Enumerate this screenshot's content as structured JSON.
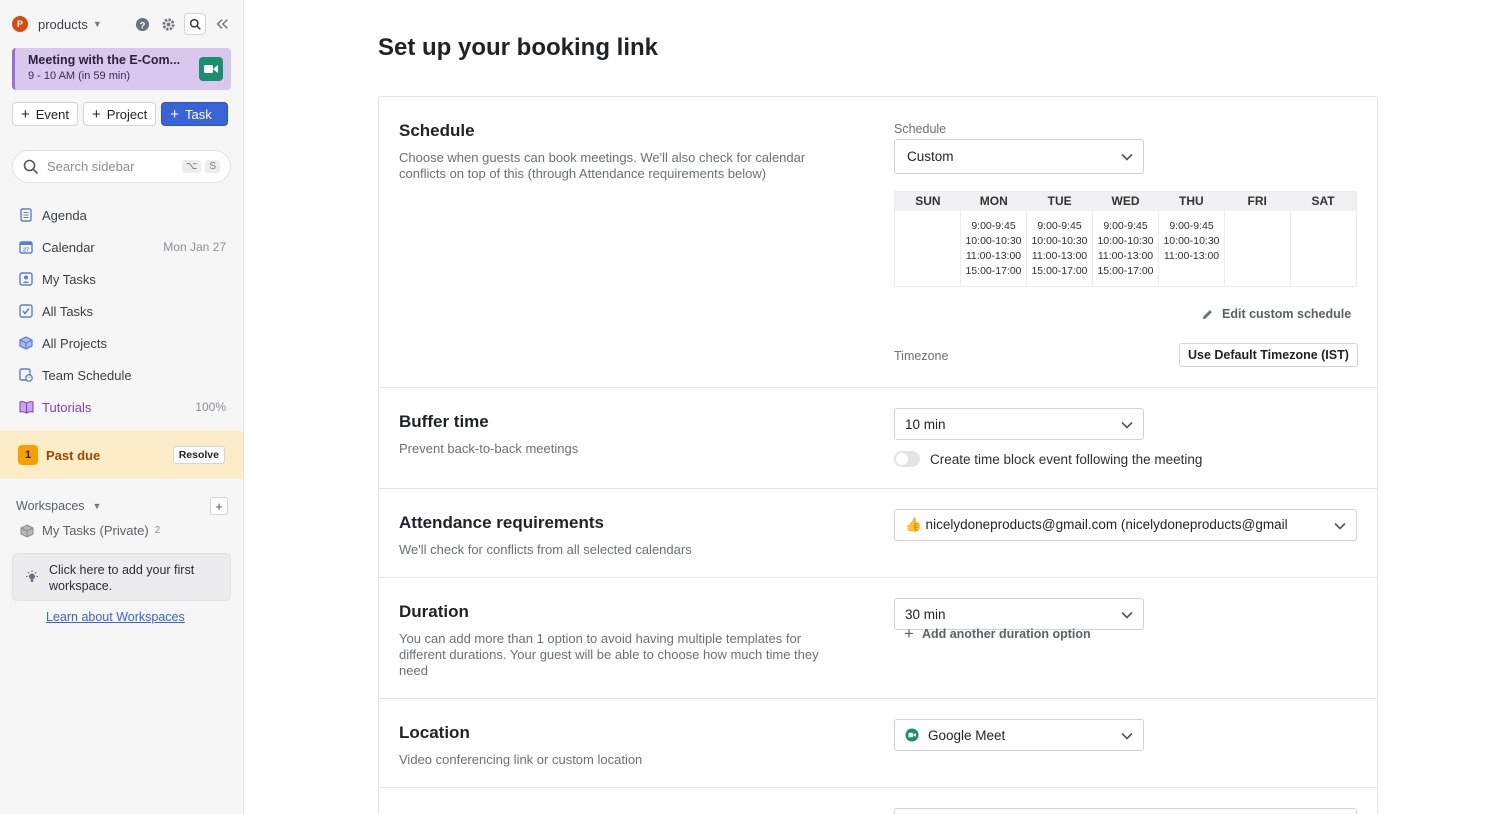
{
  "sidebar": {
    "workspace": {
      "initial": "P",
      "name": "products"
    },
    "meeting": {
      "title": "Meeting with the E-Com...",
      "time": "9 - 10 AM (in 59 min)"
    },
    "create": {
      "event": "Event",
      "project": "Project",
      "task": "Task"
    },
    "search": {
      "placeholder": "Search sidebar",
      "shortcut_a": "⌥",
      "shortcut_b": "S"
    },
    "nav": [
      {
        "label": "Agenda",
        "meta": ""
      },
      {
        "label": "Calendar",
        "meta": "Mon Jan 27"
      },
      {
        "label": "My Tasks",
        "meta": ""
      },
      {
        "label": "All Tasks",
        "meta": ""
      },
      {
        "label": "All Projects",
        "meta": ""
      },
      {
        "label": "Team Schedule",
        "meta": ""
      },
      {
        "label": "Tutorials",
        "meta": "100%"
      }
    ],
    "past_due": {
      "count": "1",
      "label": "Past due",
      "action": "Resolve"
    },
    "workspaces": {
      "header": "Workspaces",
      "private_label": "My Tasks (Private)",
      "private_count": "2",
      "tip": "Click here to add your first workspace.",
      "learn_link": "Learn about Workspaces"
    }
  },
  "main": {
    "title": "Set up your booking link",
    "schedule": {
      "title": "Schedule",
      "desc": "Choose when guests can book meetings. We'll also check for calendar conflicts on top of this (through Attendance requirements below)",
      "field_label": "Schedule",
      "value": "Custom",
      "days": [
        "SUN",
        "MON",
        "TUE",
        "WED",
        "THU",
        "FRI",
        "SAT"
      ],
      "slots": {
        "sun": [],
        "mon": [
          "9:00-9:45",
          "10:00-10:30",
          "11:00-13:00",
          "15:00-17:00"
        ],
        "tue": [
          "9:00-9:45",
          "10:00-10:30",
          "11:00-13:00",
          "15:00-17:00"
        ],
        "wed": [
          "9:00-9:45",
          "10:00-10:30",
          "11:00-13:00",
          "15:00-17:00"
        ],
        "thu": [
          "9:00-9:45",
          "10:00-10:30",
          "11:00-13:00"
        ],
        "fri": [],
        "sat": []
      },
      "edit_label": "Edit custom schedule",
      "timezone_label": "Timezone",
      "timezone_button": "Use Default Timezone (IST)"
    },
    "buffer": {
      "title": "Buffer time",
      "desc": "Prevent back-to-back meetings",
      "value": "10 min",
      "toggle_label": "Create time block event following the meeting",
      "toggle_on": false
    },
    "attendance": {
      "title": "Attendance requirements",
      "desc": "We'll check for conflicts from all selected calendars",
      "value": "👍 nicelydoneproducts@gmail.com (nicelydoneproducts@gmail"
    },
    "duration": {
      "title": "Duration",
      "desc": "You can add more than 1 option to avoid having multiple templates for different durations. Your guest will be able to choose how much time they need",
      "value": "30 min",
      "add_label": "Add another duration option"
    },
    "location": {
      "title": "Location",
      "desc": "Video conferencing link or custom location",
      "value": "Google Meet"
    }
  },
  "colors": {
    "primary": "#3b63d8",
    "meeting_bg": "#d9c7ee",
    "meet_icon": "#1a8f6e",
    "past_due_bg": "#fdecc8",
    "tutorials": "#7b3fc4"
  }
}
